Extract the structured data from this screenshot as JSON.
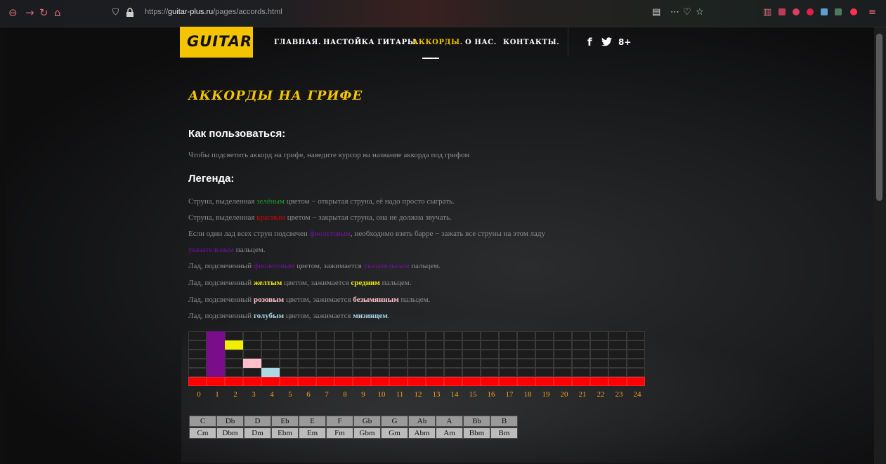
{
  "browser": {
    "url_host": "guitar-plus.ru",
    "url_prefix": "https://",
    "url_path": "/pages/accords.html"
  },
  "site": {
    "logo": "GUITAR+",
    "menu": [
      {
        "label": "ГЛАВНАЯ.",
        "active": false
      },
      {
        "label": "НАСТОЙКА ГИТАРЫ.",
        "active": false
      },
      {
        "label": "АККОРДЫ.",
        "active": true
      },
      {
        "label": "О НАС.",
        "active": false
      },
      {
        "label": "КОНТАКТЫ.",
        "active": false
      }
    ],
    "social": [
      "f",
      "🐦",
      "8+"
    ]
  },
  "content": {
    "title": "АККОРДЫ НА ГРИФЕ",
    "howto_heading": "Как пользоваться:",
    "howto_text": "Чтобы подсветить аккорд на грифе, наведите курсор на название аккорда под грифом",
    "legend_heading": "Легенда:",
    "legend": {
      "l1a": "Струна, выделенная ",
      "l1b": "зелёным",
      "l1c": " цветом − открытая струна, её надо просто сыграть.",
      "l2a": "Струна, выделенная ",
      "l2b": "красным",
      "l2c": " цветом − закрытая струна, она не должна звучать.",
      "l3a": "Если один лад всех струн подсвечен ",
      "l3b": "фиолетовым",
      "l3c": ", необходимо взять барре − зажать все струны на этом ладу",
      "l4a": "указательным",
      "l4b": " пальцем.",
      "l5a": "Лад, подсвеченный ",
      "l5b": "фиолетовым",
      "l5c": " цветом, зажимается ",
      "l5d": "указательным",
      "l5e": " пальцем.",
      "l6a": "Лад, подсвеченный ",
      "l6b": "желтым",
      "l6c": " цветом, зажимается ",
      "l6d": "средним",
      "l6e": " пальцем.",
      "l7a": "Лад, подсвеченный ",
      "l7b": "розовым",
      "l7c": " цветом, зажимается ",
      "l7d": "безымянным",
      "l7e": " пальцем.",
      "l8a": "Лад, подсвеченный ",
      "l8b": "голубым",
      "l8c": " цветом, зажимается ",
      "l8d": "мизинцем",
      "l8e": "."
    }
  },
  "fretboard": {
    "strings": 6,
    "frets": 25,
    "fret_numbers": [
      "0",
      "1",
      "2",
      "3",
      "4",
      "5",
      "6",
      "7",
      "8",
      "9",
      "10",
      "11",
      "12",
      "13",
      "14",
      "15",
      "16",
      "17",
      "18",
      "19",
      "20",
      "21",
      "22",
      "23",
      "24"
    ],
    "colors": {
      "empty": "#1c1c1c",
      "barre": "#7a0e8a",
      "middle": "#f2f000",
      "ring": "#ffc0cb",
      "pinky": "#add8e6",
      "muted": "#ff0000"
    },
    "highlights": [
      {
        "string": 0,
        "fret": 1,
        "finger": "barre"
      },
      {
        "string": 1,
        "fret": 1,
        "finger": "barre"
      },
      {
        "string": 2,
        "fret": 1,
        "finger": "barre"
      },
      {
        "string": 3,
        "fret": 1,
        "finger": "barre"
      },
      {
        "string": 4,
        "fret": 1,
        "finger": "barre"
      },
      {
        "string": 1,
        "fret": 2,
        "finger": "middle"
      },
      {
        "string": 3,
        "fret": 3,
        "finger": "ring"
      },
      {
        "string": 4,
        "fret": 4,
        "finger": "pinky"
      }
    ],
    "muted_string": 5
  },
  "chords": {
    "major": [
      "C",
      "Db",
      "D",
      "Eb",
      "E",
      "F",
      "Gb",
      "G",
      "Ab",
      "A",
      "Bb",
      "B"
    ],
    "minor": [
      "Cm",
      "Dbm",
      "Dm",
      "Ebm",
      "Em",
      "Fm",
      "Gbm",
      "Gm",
      "Abm",
      "Am",
      "Bbm",
      "Bm"
    ]
  }
}
